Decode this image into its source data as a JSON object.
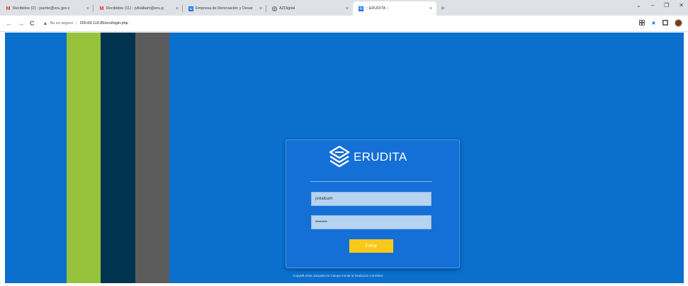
{
  "tabs": [
    {
      "favicon": "gmail-icon",
      "title": "Recibidos (2) - jsantiz@eru.gov.c",
      "close": "×"
    },
    {
      "favicon": "gmail-icon",
      "title": "Recibidos (11) - jvillalbam@eru.g",
      "close": "×"
    },
    {
      "favicon": "docs-icon",
      "title": "Empresa de Renovación y Desar",
      "close": "×"
    },
    {
      "favicon": "web-icon",
      "title": "AZDigital",
      "close": "×"
    },
    {
      "favicon": "erudita-favicon",
      "title": ":: ERUDITA ::",
      "close": "×"
    }
  ],
  "new_tab_label": "+",
  "window_controls": {
    "menu": "⌄",
    "minimize": "–",
    "maximize": "❐",
    "close": "✕"
  },
  "toolbar": {
    "back": "←",
    "forward": "→",
    "reload": "C",
    "security_warning": "▲",
    "security_text": "No es seguro",
    "separator": "|",
    "url": "200.69.119.85/eru/login.php"
  },
  "page": {
    "stripe_colors": [
      "#96c33b",
      "#00334d",
      "#5c5c5c"
    ],
    "background": "#0b6fce",
    "logo_text": "ERUDITA",
    "username_value": "jvillalbam",
    "password_value": "••••••••",
    "submit_label": "Entrar",
    "footer": "Copyleft 2016 Jazuado en Calope 0.9 de la fundación Correltive"
  }
}
